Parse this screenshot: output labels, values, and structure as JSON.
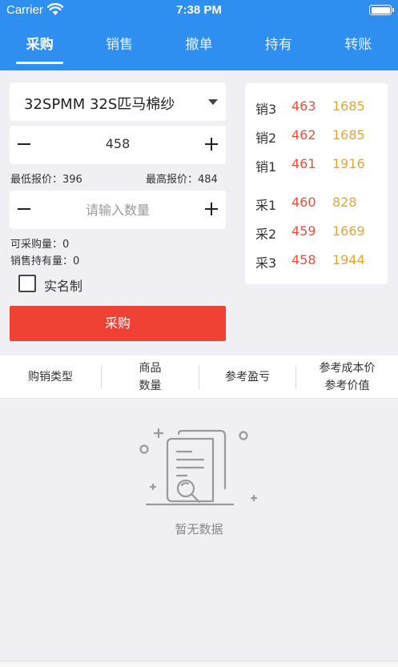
{
  "status": {
    "carrier": "Carrier",
    "time": "7:38 PM"
  },
  "tabs": [
    {
      "label": "采购",
      "active": true
    },
    {
      "label": "销售",
      "active": false
    },
    {
      "label": "撤单",
      "active": false
    },
    {
      "label": "持有",
      "active": false
    },
    {
      "label": "转账",
      "active": false
    }
  ],
  "form": {
    "product": "32SPMM  32S匹马棉纱",
    "price_value": "458",
    "min_price_label": "最低报价：396",
    "max_price_label": "最高报价：484",
    "quantity_placeholder": "请输入数量",
    "available_label": "可采购量：0",
    "holding_label": "销售持有量：0",
    "realname_label": "实名制",
    "submit_label": "采购"
  },
  "orderbook": {
    "rows": [
      {
        "label": "销3",
        "price": "463",
        "qty": "1685"
      },
      {
        "label": "销2",
        "price": "462",
        "qty": "1685"
      },
      {
        "label": "销1",
        "price": "461",
        "qty": "1916"
      },
      {
        "label": "采1",
        "price": "460",
        "qty": "828"
      },
      {
        "label": "采2",
        "price": "459",
        "qty": "1669"
      },
      {
        "label": "采3",
        "price": "458",
        "qty": "1944"
      }
    ]
  },
  "table": {
    "col1": "购销类型",
    "col2_line1": "商品",
    "col2_line2": "数量",
    "col3": "参考盈亏",
    "col4_line1": "参考成本价",
    "col4_line2": "参考价值"
  },
  "empty_state": {
    "text": "暂无数据",
    "icon": "document-search-icon"
  },
  "colors": {
    "header": "#2f8ff0",
    "buy_button": "#f04234",
    "price": "#e2533e",
    "quantity": "#e9a52b"
  }
}
